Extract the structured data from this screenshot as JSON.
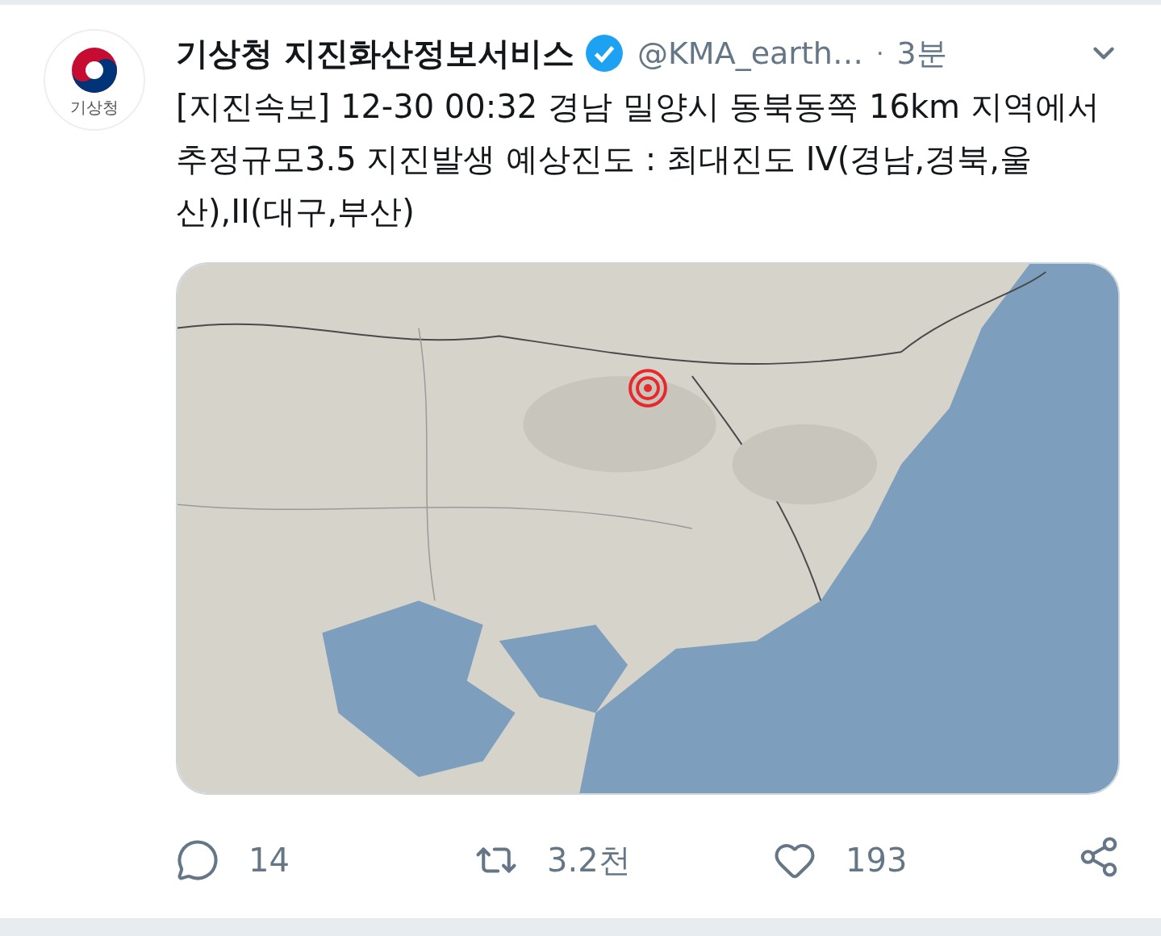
{
  "tweet": {
    "avatar_text": "기상청",
    "author": "기상청 지진화산정보서비스",
    "verified": true,
    "handle": "@KMA_earth…",
    "separator": "·",
    "time": "3분",
    "text": "[지진속보] 12-30 00:32 경남 밀양시 동북동쪽 16km 지역에서 추정규모3.5 지진발생 예상진도 : 최대진도 IV(경남,경북,울산),II(대구,부산)",
    "actions": [
      {
        "kind": "reply",
        "count": "14"
      },
      {
        "kind": "retweet",
        "count": "3.2천"
      },
      {
        "kind": "like",
        "count": "193"
      },
      {
        "kind": "share"
      }
    ]
  }
}
